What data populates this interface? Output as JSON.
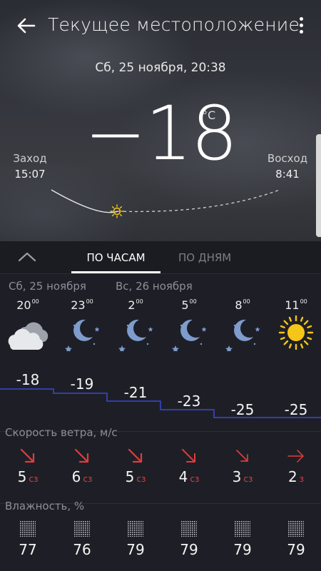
{
  "header": {
    "title": "Текущее местоположение",
    "datetime": "Сб, 25 ноября, 20:38"
  },
  "current": {
    "temperature": "−18",
    "unit": "°C",
    "sunset_label": "Заход",
    "sunset_time": "15:07",
    "sunrise_label": "Восход",
    "sunrise_time": "8:41"
  },
  "tabs": {
    "hourly": "ПО ЧАСАМ",
    "daily": "ПО ДНЯМ"
  },
  "forecast": {
    "day1": "Сб, 25 ноября",
    "day2": "Вс, 26 ноября",
    "hours": [
      {
        "h": "20",
        "icon": "cloudy-icon",
        "temp": "-18",
        "wind": "5",
        "wind_dir": "сз",
        "wind_arrow": "↘",
        "humidity": "77"
      },
      {
        "h": "23",
        "icon": "clear-night-icon",
        "temp": "-19",
        "wind": "6",
        "wind_dir": "сз",
        "wind_arrow": "↘",
        "humidity": "76"
      },
      {
        "h": "2",
        "icon": "clear-night-icon",
        "temp": "-21",
        "wind": "5",
        "wind_dir": "сз",
        "wind_arrow": "↘",
        "humidity": "79"
      },
      {
        "h": "5",
        "icon": "clear-night-icon",
        "temp": "-23",
        "wind": "4",
        "wind_dir": "сз",
        "wind_arrow": "↘",
        "humidity": "79"
      },
      {
        "h": "8",
        "icon": "clear-night-icon",
        "temp": "-25",
        "wind": "3",
        "wind_dir": "сз",
        "wind_arrow": "↘",
        "humidity": "79"
      },
      {
        "h": "11",
        "icon": "sunny-icon",
        "temp": "-25",
        "wind": "2",
        "wind_dir": "з",
        "wind_arrow": "→",
        "humidity": "79"
      }
    ],
    "minutes_sup": "00",
    "wind_title": "Скорость ветра, м/с",
    "humidity_title": "Влажность, %"
  },
  "colors": {
    "temp_line": "#3a47d8",
    "wind_arrow": "#e03c3c",
    "sun": "#f5c518",
    "moon": "#7e9ccc"
  }
}
